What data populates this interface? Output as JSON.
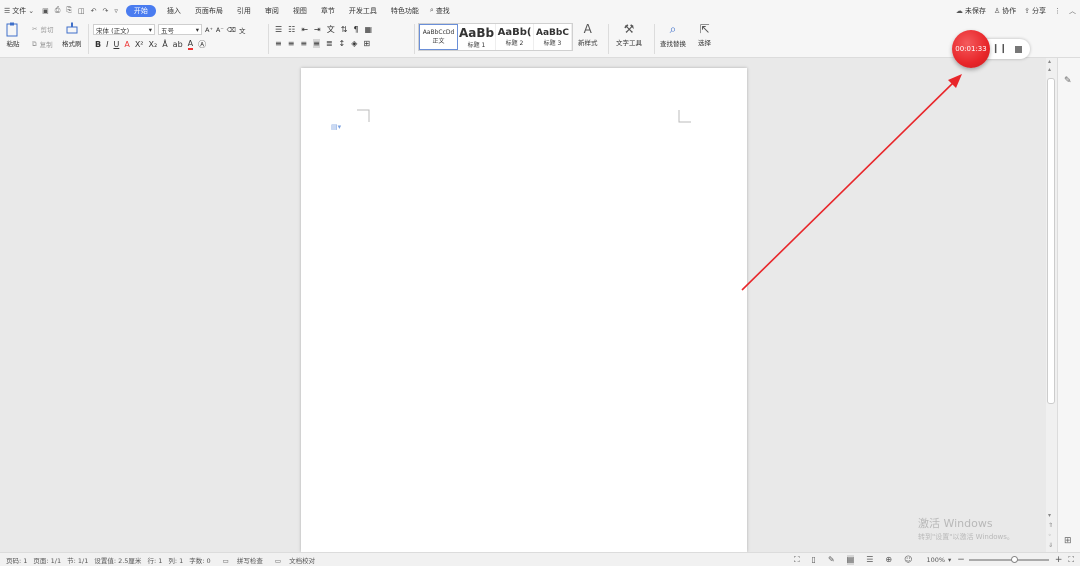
{
  "menubar": {
    "file": "文件",
    "tabs": [
      "开始",
      "插入",
      "页面布局",
      "引用",
      "审阅",
      "视图",
      "章节",
      "开发工具",
      "特色功能"
    ],
    "search": "查找",
    "unsaved": "未保存",
    "collab": "协作",
    "share": "分享"
  },
  "ribbon": {
    "paste": "粘贴",
    "cut": "剪切",
    "copy": "复制",
    "format_painter": "格式刷",
    "font_name": "宋体 (正文)",
    "font_size": "五号",
    "styles": [
      {
        "sample": "AaBbCcDd",
        "label": "正文"
      },
      {
        "sample": "AaBb",
        "label": "标题 1"
      },
      {
        "sample": "AaBb(",
        "label": "标题 2"
      },
      {
        "sample": "AaBbC",
        "label": "标题 3"
      }
    ],
    "new_style": "新样式",
    "text_tools": "文字工具",
    "find_replace": "查找替换",
    "select": "选择"
  },
  "recorder": {
    "time": "00:01:33",
    "color": "#e8262a"
  },
  "watermark": {
    "line1": "激活 Windows",
    "line2": "转到\"设置\"以激活 Windows。"
  },
  "status": {
    "page": "页码: 1",
    "pages": "页面: 1/1",
    "section": "节: 1/1",
    "position": "设置值: 2.5厘米",
    "row": "行: 1",
    "col": "列: 1",
    "words": "字数: 0",
    "spell": "拼写检查",
    "proof": "文档校对",
    "zoom": "100%"
  },
  "colors": {
    "accent": "#4a7cf0",
    "arrow": "#e8262a"
  }
}
